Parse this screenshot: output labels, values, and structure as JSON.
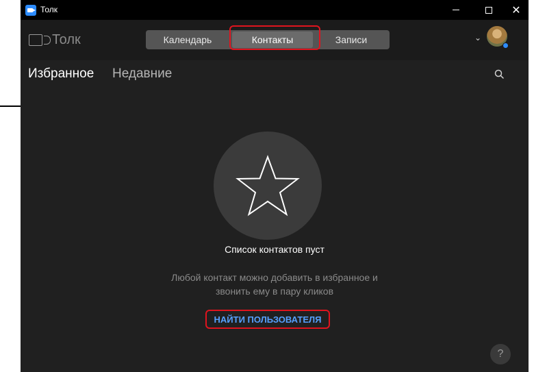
{
  "window": {
    "title": "Толк"
  },
  "header": {
    "logo_text": "Толк",
    "tabs": [
      {
        "label": "Календарь"
      },
      {
        "label": "Контакты",
        "active": true
      },
      {
        "label": "Записи"
      }
    ]
  },
  "subtabs": [
    {
      "label": "Избранное",
      "active": true
    },
    {
      "label": "Недавние"
    }
  ],
  "empty_state": {
    "title": "Список контактов пуст",
    "desc_line1": "Любой контакт можно добавить в избранное и",
    "desc_line2": "звонить ему в пару кликов",
    "action": "НАЙТИ ПОЛЬЗОВАТЕЛЯ"
  },
  "help_label": "?",
  "colors": {
    "accent": "#2d8cff",
    "link": "#56a0ff",
    "highlight": "#e0141e",
    "background": "#202020"
  },
  "icons": [
    "app-logo-icon",
    "video-camera-icon",
    "chevron-down-icon",
    "avatar",
    "search-icon",
    "star-icon",
    "help-icon"
  ]
}
